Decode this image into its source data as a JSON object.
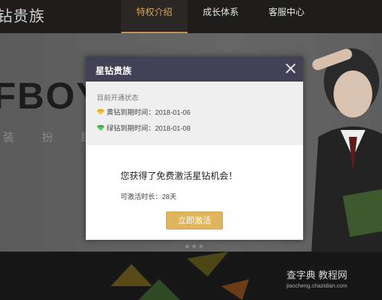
{
  "header": {
    "brand": "钻贵族",
    "tabs": [
      {
        "label": "特权介绍",
        "active": true
      },
      {
        "label": "成长体系",
        "active": false
      },
      {
        "label": "客服中心",
        "active": false
      }
    ]
  },
  "banner": {
    "headline": "FBOY",
    "subtitle": "装 扮 即 将"
  },
  "modal": {
    "title": "星钻贵族",
    "status": {
      "heading": "目前开通状态",
      "rows": [
        {
          "icon": "yellow-diamond-icon",
          "color": "#e7a51f",
          "text": "黄钻到期时间：2018-01-06"
        },
        {
          "icon": "green-diamond-icon",
          "color": "#3bbf48",
          "text": "绿钻到期时间：2018-01-08"
        }
      ]
    },
    "offer": "您获得了免费激活星钻机会！",
    "duration": "可激活时长：28天",
    "button": "立即激活"
  },
  "watermark": {
    "line1": "查字典 教程网",
    "line2": "jiaocheng.chazidian.com"
  },
  "colors": {
    "modal_header": "#424156",
    "accent": "#e0b560",
    "active_tab": "#d8a85a"
  }
}
